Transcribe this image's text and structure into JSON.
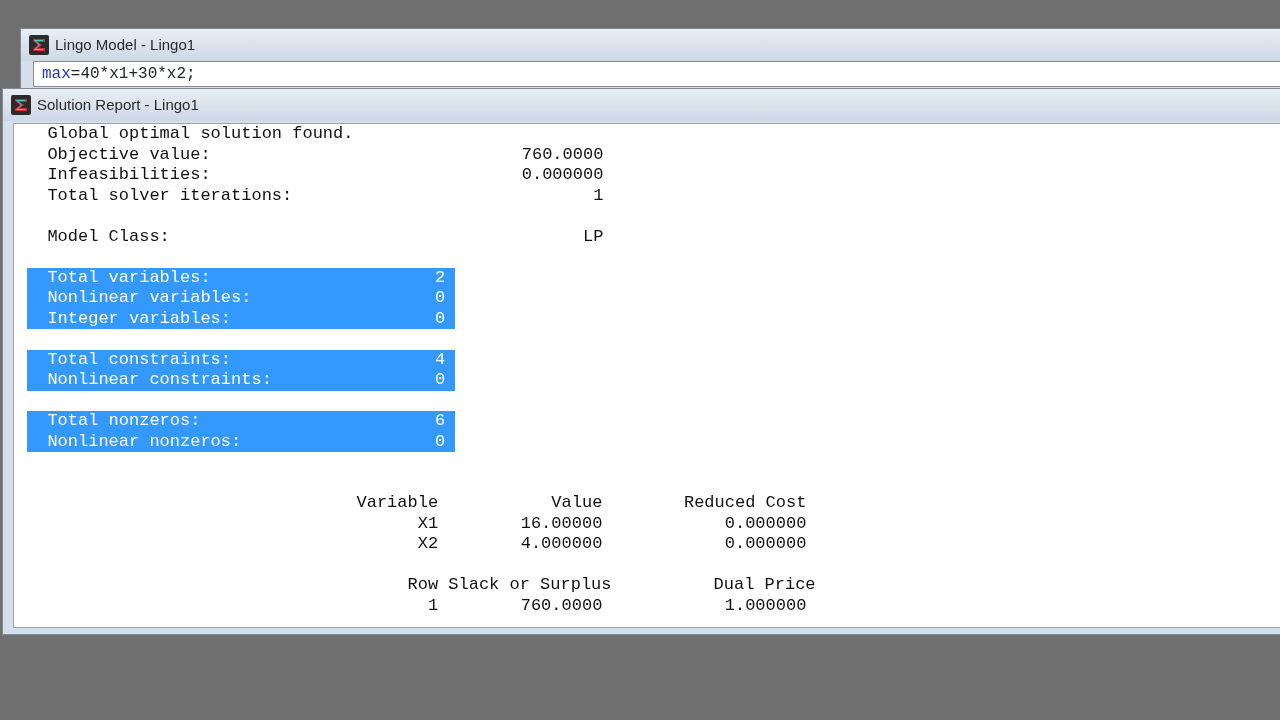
{
  "model_window": {
    "title": "Lingo Model - Lingo1",
    "code": [
      {
        "text": "max",
        "kind": "keyword"
      },
      {
        "text": "=40*x1+30*x2;",
        "kind": "plain"
      }
    ]
  },
  "report_window": {
    "title": "Solution Report - Lingo1",
    "summary_groups": [
      [
        {
          "label": "Global optimal solution found."
        },
        {
          "label": "Objective value:",
          "value": "760.0000"
        },
        {
          "label": "Infeasibilities:",
          "value": "0.000000"
        },
        {
          "label": "Total solver iterations:",
          "value": "1"
        }
      ],
      [
        {
          "label": "Model Class:",
          "value": "LP"
        }
      ]
    ],
    "statistics_groups": [
      [
        {
          "label": "Total variables:",
          "value": "2",
          "selected": true
        },
        {
          "label": "Nonlinear variables:",
          "value": "0",
          "selected": true
        },
        {
          "label": "Integer variables:",
          "value": "0",
          "selected": true
        }
      ],
      [
        {
          "label": "Total constraints:",
          "value": "4",
          "selected": true
        },
        {
          "label": "Nonlinear constraints:",
          "value": "0",
          "selected": true
        }
      ],
      [
        {
          "label": "Total nonzeros:",
          "value": "6",
          "selected": true
        },
        {
          "label": "Nonlinear nonzeros:",
          "value": "0",
          "selected": true
        }
      ]
    ],
    "tables": [
      {
        "columns": [
          "Variable",
          "Value",
          "Reduced Cost"
        ],
        "rows": [
          [
            "X1",
            "16.00000",
            "0.000000"
          ],
          [
            "X2",
            "4.000000",
            "0.000000"
          ]
        ]
      },
      {
        "columns": [
          "Row",
          "Slack or Surplus",
          "Dual Price"
        ],
        "rows": [
          [
            "1",
            "760.0000",
            "1.000000"
          ]
        ]
      }
    ]
  }
}
